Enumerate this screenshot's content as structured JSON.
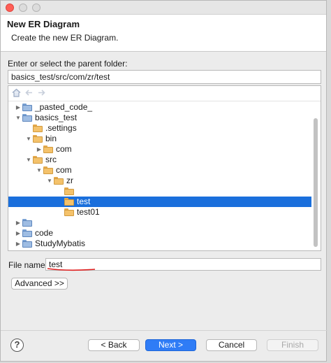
{
  "header": {
    "title": "New ER Diagram",
    "subtitle": "Create the new ER Diagram."
  },
  "parent_folder": {
    "label": "Enter or select the parent folder:",
    "value": "basics_test/src/com/zr/test"
  },
  "tree": {
    "toolbar_icons": [
      "home-icon",
      "back-icon",
      "forward-icon"
    ],
    "items": [
      {
        "label": "_pasted_code_",
        "level": 1,
        "expander": "collapsed",
        "kind": "project"
      },
      {
        "label": "basics_test",
        "level": 1,
        "expander": "expanded",
        "kind": "project"
      },
      {
        "label": ".settings",
        "level": 2,
        "expander": "none",
        "kind": "folder"
      },
      {
        "label": "bin",
        "level": 2,
        "expander": "expanded",
        "kind": "folder"
      },
      {
        "label": "com",
        "level": 3,
        "expander": "collapsed",
        "kind": "folder"
      },
      {
        "label": "src",
        "level": 2,
        "expander": "expanded",
        "kind": "folder"
      },
      {
        "label": "com",
        "level": 3,
        "expander": "expanded",
        "kind": "folder"
      },
      {
        "label": "zr",
        "level": 4,
        "expander": "expanded",
        "kind": "folder"
      },
      {
        "label": "",
        "level": 5,
        "expander": "none",
        "kind": "folder"
      },
      {
        "label": "test",
        "level": 5,
        "expander": "none",
        "kind": "folder",
        "selected": true
      },
      {
        "label": "test01",
        "level": 5,
        "expander": "none",
        "kind": "folder"
      },
      {
        "label": "",
        "level": 1,
        "expander": "collapsed",
        "kind": "project"
      },
      {
        "label": "code",
        "level": 1,
        "expander": "collapsed",
        "kind": "project"
      },
      {
        "label": "StudyMybatis",
        "level": 1,
        "expander": "collapsed",
        "kind": "project"
      }
    ]
  },
  "file_name": {
    "label": "File name:",
    "value": "test"
  },
  "buttons": {
    "advanced": "Advanced >>",
    "back": "< Back",
    "next": "Next >",
    "cancel": "Cancel",
    "finish": "Finish",
    "help": "?"
  },
  "colors": {
    "selection": "#1a6fdc",
    "primary_button": "#2f7cf6",
    "annotation_underline": "#e02020"
  }
}
